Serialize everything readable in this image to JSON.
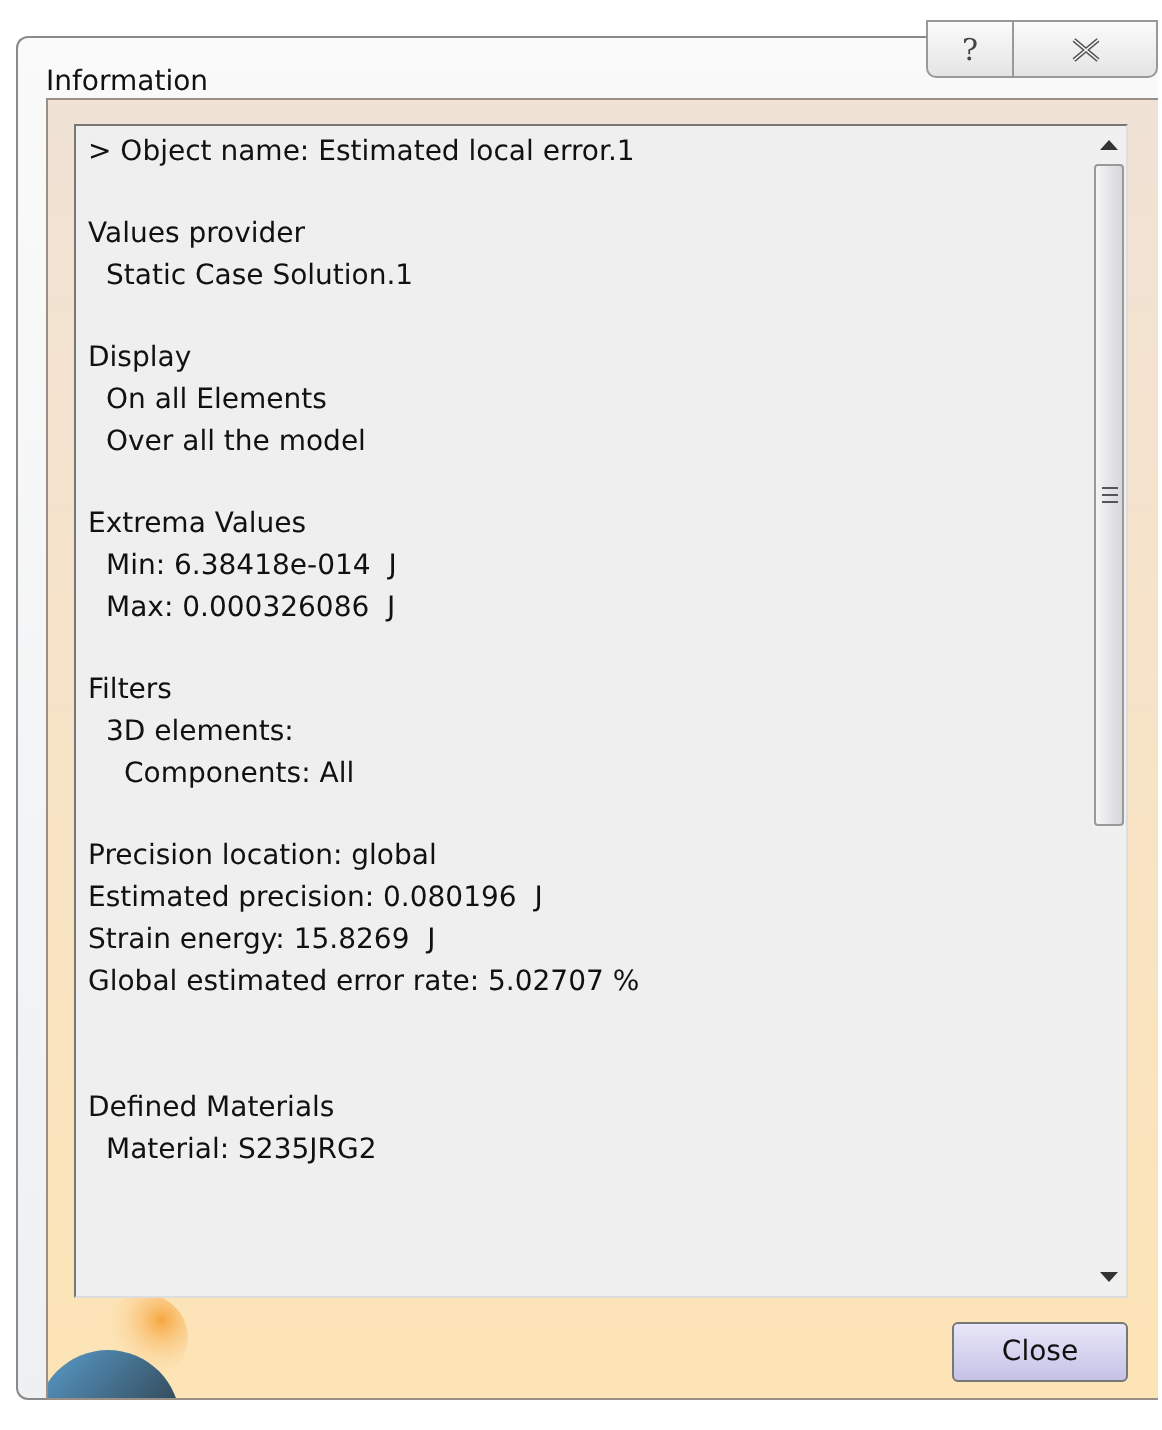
{
  "window": {
    "title": "Information",
    "help_button": "?"
  },
  "content": {
    "blocks": [
      {
        "lines": [
          {
            "text": "> Object name: Estimated local error.1"
          }
        ]
      },
      {
        "lines": [
          {
            "text": "Values provider",
            "children": [
              {
                "text": "Static Case Solution.1"
              }
            ]
          }
        ]
      },
      {
        "lines": [
          {
            "text": "Display",
            "children": [
              {
                "text": "On all Elements"
              },
              {
                "text": "Over all the model"
              }
            ]
          }
        ]
      },
      {
        "lines": [
          {
            "text": "Extrema Values",
            "children": [
              {
                "text": "Min: 6.38418e-014  J"
              },
              {
                "text": "Max: 0.000326086  J"
              }
            ]
          }
        ]
      },
      {
        "lines": [
          {
            "text": "Filters",
            "children": [
              {
                "text": "3D elements:",
                "children": [
                  {
                    "text": "Components: All"
                  }
                ]
              }
            ]
          }
        ]
      },
      {
        "lines": [
          {
            "text": "Precision location: global"
          },
          {
            "text": "Estimated precision: 0.080196  J"
          },
          {
            "text": "Strain energy: 15.8269  J"
          },
          {
            "text": "Global estimated error rate: 5.02707 %"
          }
        ]
      },
      {
        "lines": [
          {
            "text": "Defined Materials",
            "children": [
              {
                "text": "Material: S235JRG2"
              }
            ]
          }
        ]
      }
    ]
  },
  "buttons": [
    {
      "label": "Close"
    }
  ]
}
